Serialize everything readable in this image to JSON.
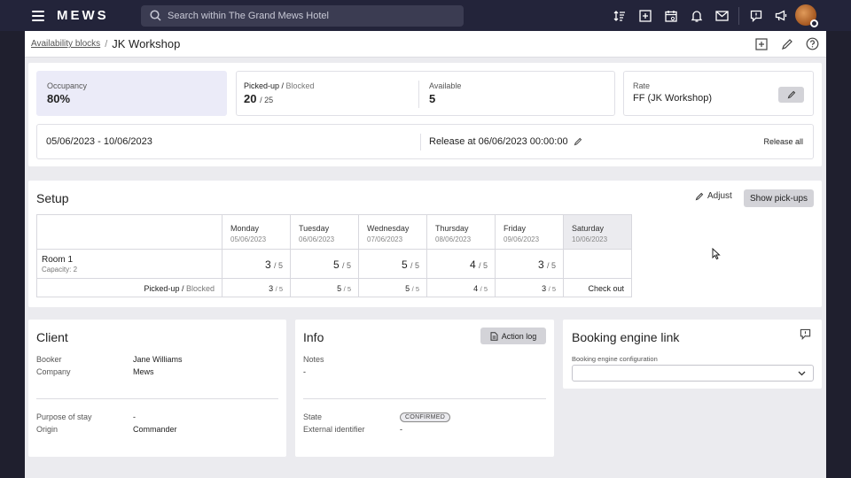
{
  "app": {
    "logo": "MEWS",
    "search_placeholder": "Search within The Grand Mews Hotel"
  },
  "topbar_icons": [
    "sort-icon",
    "add-box-icon",
    "calendar-icon",
    "bell-icon",
    "mail-icon",
    "feedback-icon",
    "megaphone-icon",
    "avatar"
  ],
  "breadcrumb": {
    "parent": "Availability blocks",
    "separator": "/",
    "title": "JK Workshop"
  },
  "summary": {
    "occupancy_label": "Occupancy",
    "occupancy_value": "80%",
    "picked_label": "Picked-up",
    "picked_sep": " / ",
    "blocked_label": "Blocked",
    "picked_value": "20",
    "blocked_value": "/ 25",
    "available_label": "Available",
    "available_value": "5",
    "rate_label": "Rate",
    "rate_value": "FF (JK Workshop)",
    "date_range": "05/06/2023 - 10/06/2023",
    "release_text": "Release at 06/06/2023 00:00:00",
    "release_all": "Release all"
  },
  "setup": {
    "title": "Setup",
    "adjust_label": "Adjust",
    "show_pickups_label": "Show pick-ups",
    "days": [
      {
        "day": "Monday",
        "date": "05/06/2023"
      },
      {
        "day": "Tuesday",
        "date": "06/06/2023"
      },
      {
        "day": "Wednesday",
        "date": "07/06/2023"
      },
      {
        "day": "Thursday",
        "date": "08/06/2023"
      },
      {
        "day": "Friday",
        "date": "09/06/2023"
      },
      {
        "day": "Saturday",
        "date": "10/06/2023"
      }
    ],
    "room": {
      "name": "Room 1",
      "capacity": "Capacity: 2"
    },
    "room_values": [
      {
        "v": "3",
        "t": "/ 5"
      },
      {
        "v": "5",
        "t": "/ 5"
      },
      {
        "v": "5",
        "t": "/ 5"
      },
      {
        "v": "4",
        "t": "/ 5"
      },
      {
        "v": "3",
        "t": "/ 5"
      }
    ],
    "footer_label_picked": "Picked-up",
    "footer_label_sep": " / ",
    "footer_label_blocked": "Blocked",
    "footer_values": [
      {
        "v": "3",
        "t": "/ 5"
      },
      {
        "v": "5",
        "t": "/ 5"
      },
      {
        "v": "5",
        "t": "/ 5"
      },
      {
        "v": "4",
        "t": "/ 5"
      },
      {
        "v": "3",
        "t": "/ 5"
      }
    ],
    "checkout_label": "Check out"
  },
  "client": {
    "title": "Client",
    "booker_label": "Booker",
    "booker_value": "Jane Williams",
    "company_label": "Company",
    "company_value": "Mews",
    "purpose_label": "Purpose of stay",
    "purpose_value": "-",
    "origin_label": "Origin",
    "origin_value": "Commander"
  },
  "info": {
    "title": "Info",
    "action_log_label": "Action log",
    "notes_label": "Notes",
    "notes_value": "-",
    "state_label": "State",
    "state_value": "CONFIRMED",
    "external_label": "External identifier",
    "external_value": "-"
  },
  "booking": {
    "title": "Booking engine link",
    "config_label": "Booking engine configuration",
    "config_value": ""
  }
}
